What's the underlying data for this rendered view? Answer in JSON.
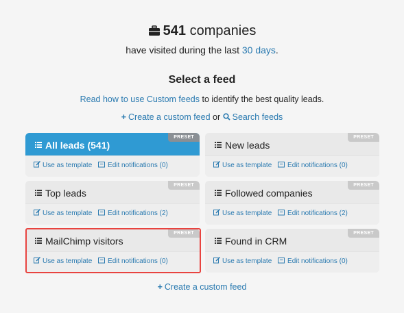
{
  "header": {
    "count": "541",
    "count_suffix": " companies",
    "visited_text": "have visited during the last ",
    "period_link": "30 days",
    "period_end": "."
  },
  "feeds": {
    "title": "Select a feed",
    "read_link": "Read how to use Custom feeds",
    "read_rest": " to identify the best quality leads.",
    "create_label": "Create a custom feed",
    "or_text": " or ",
    "search_label": "Search feeds",
    "bottom_create_label": "Create a custom feed"
  },
  "cards": [
    {
      "title": "All leads (541)",
      "preset": "PRESET",
      "template": "Use as template",
      "notifications": "Edit notifications (0)"
    },
    {
      "title": "New leads",
      "preset": "PRESET",
      "template": "Use as template",
      "notifications": "Edit notifications (0)"
    },
    {
      "title": "Top leads",
      "preset": "PRESET",
      "template": "Use as template",
      "notifications": "Edit notifications (2)"
    },
    {
      "title": "Followed companies",
      "preset": "PRESET",
      "template": "Use as template",
      "notifications": "Edit notifications (2)"
    },
    {
      "title": "MailChimp visitors",
      "preset": "PRESET",
      "template": "Use as template",
      "notifications": "Edit notifications (0)"
    },
    {
      "title": "Found in CRM",
      "preset": "PRESET",
      "template": "Use as template",
      "notifications": "Edit notifications (0)"
    }
  ],
  "colors": {
    "accent": "#2f9ad3",
    "link": "#2a7ab0",
    "highlight": "#e8433f"
  }
}
